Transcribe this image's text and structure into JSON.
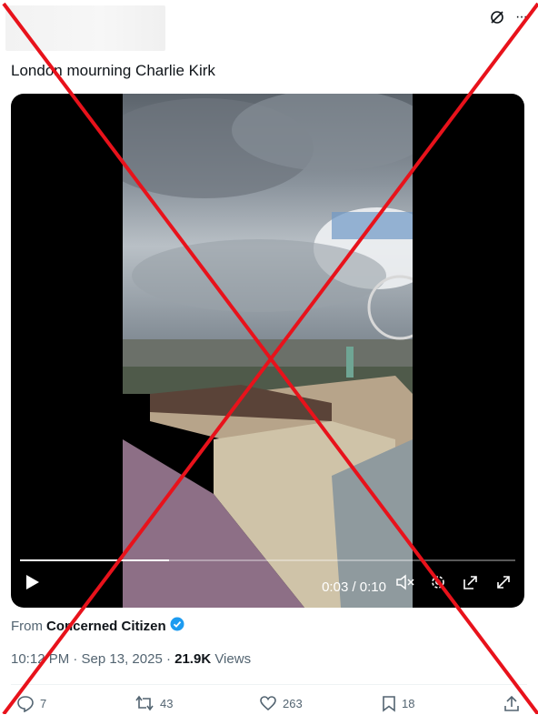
{
  "header": {
    "more_label": "···"
  },
  "tweet": {
    "text": "London mourning Charlie Kirk"
  },
  "video": {
    "time": "0:03 / 0:10",
    "progress": 0.3
  },
  "source": {
    "prefix": "From",
    "name": "Concerned Citizen"
  },
  "meta": {
    "time": "10:12 PM · Sep 13, 2025 ·",
    "views_count": "21.9K",
    "views_label": "Views"
  },
  "actions": {
    "replies": "7",
    "reposts": "43",
    "likes": "263",
    "bookmarks": "18"
  },
  "colors": {
    "verified": "#1d9bf0",
    "cross": "#e8121b",
    "muted": "#536471"
  }
}
